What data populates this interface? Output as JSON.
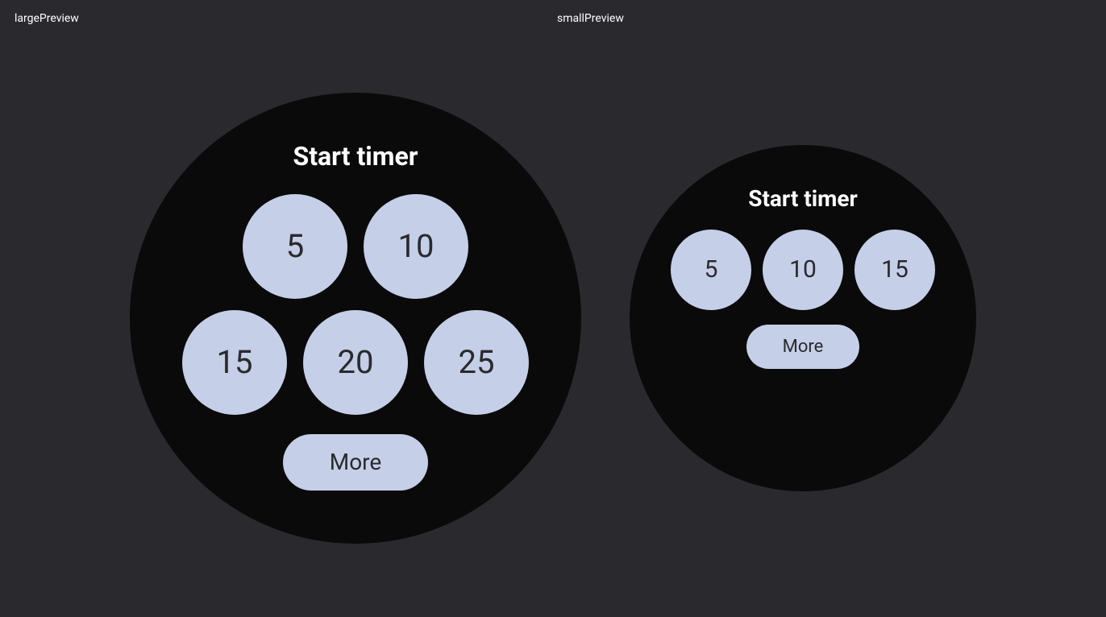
{
  "labels": {
    "large": "largePreview",
    "small": "smallPreview"
  },
  "large": {
    "title": "Start timer",
    "row1": [
      "5",
      "10"
    ],
    "row2": [
      "15",
      "20",
      "25"
    ],
    "more": "More"
  },
  "small": {
    "title": "Start timer",
    "row1": [
      "5",
      "10",
      "15"
    ],
    "more": "More"
  },
  "colors": {
    "bg": "#2a2a2e",
    "watch_bg": "#0a0a0a",
    "btn_bg": "#c5cfe8",
    "text_white": "#ffffff",
    "text_dark": "#2a2a2e"
  }
}
